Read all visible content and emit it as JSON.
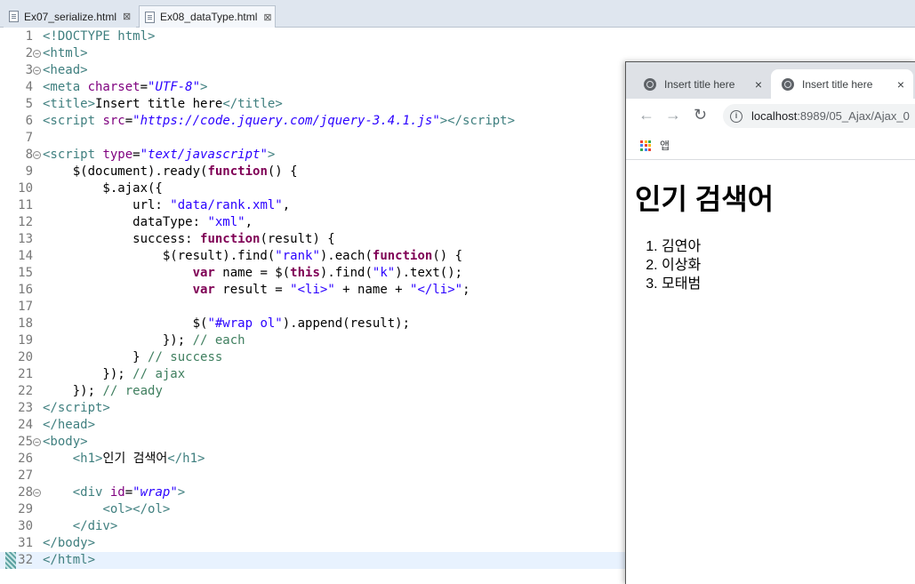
{
  "editor": {
    "tabs": [
      {
        "label": "Ex07_serialize.html",
        "close": "⊠"
      },
      {
        "label": "Ex08_dataType.html",
        "close": "⊠"
      }
    ],
    "lines": [
      {
        "n": "1",
        "fold": "",
        "html": "<span class=\"tag\">&lt;!DOCTYPE html&gt;</span>"
      },
      {
        "n": "2",
        "fold": "−",
        "html": "<span class=\"tag\">&lt;html&gt;</span>"
      },
      {
        "n": "3",
        "fold": "−",
        "html": "<span class=\"tag\">&lt;head&gt;</span>"
      },
      {
        "n": "4",
        "fold": "",
        "html": "<span class=\"tag\">&lt;meta </span><span class=\"attr\">charset</span>=<span class=\"val\">\"UTF-8\"</span><span class=\"tag\">&gt;</span>"
      },
      {
        "n": "5",
        "fold": "",
        "html": "<span class=\"tag\">&lt;title&gt;</span>Insert title here<span class=\"tag\">&lt;/title&gt;</span>"
      },
      {
        "n": "6",
        "fold": "",
        "html": "<span class=\"tag\">&lt;script </span><span class=\"attr\">src</span>=<span class=\"val\">\"https://code.jquery.com/jquery-3.4.1.js\"</span><span class=\"tag\">&gt;&lt;/script&gt;</span>"
      },
      {
        "n": "7",
        "fold": "",
        "html": ""
      },
      {
        "n": "8",
        "fold": "−",
        "html": "<span class=\"tag\">&lt;script </span><span class=\"attr\">type</span>=<span class=\"val\">\"text/javascript\"</span><span class=\"tag\">&gt;</span>"
      },
      {
        "n": "9",
        "fold": "",
        "html": "    $(document).ready(<span class=\"kw\">function</span>() {"
      },
      {
        "n": "10",
        "fold": "",
        "html": "        $.ajax({"
      },
      {
        "n": "11",
        "fold": "",
        "html": "            url: <span class=\"str\">\"data/rank.xml\"</span>,"
      },
      {
        "n": "12",
        "fold": "",
        "html": "            dataType: <span class=\"str\">\"xml\"</span>,"
      },
      {
        "n": "13",
        "fold": "",
        "html": "            success: <span class=\"kw\">function</span>(result) {"
      },
      {
        "n": "14",
        "fold": "",
        "html": "                $(result).find(<span class=\"str\">\"rank\"</span>).each(<span class=\"kw\">function</span>() {"
      },
      {
        "n": "15",
        "fold": "",
        "html": "                    <span class=\"kw\">var</span> name = $(<span class=\"kw\">this</span>).find(<span class=\"str\">\"k\"</span>).text();"
      },
      {
        "n": "16",
        "fold": "",
        "html": "                    <span class=\"kw\">var</span> result = <span class=\"str\">\"&lt;li&gt;\"</span> + name + <span class=\"str\">\"&lt;/li&gt;\"</span>;"
      },
      {
        "n": "17",
        "fold": "",
        "html": ""
      },
      {
        "n": "18",
        "fold": "",
        "html": "                    $(<span class=\"str\">\"#wrap ol\"</span>).append(result);"
      },
      {
        "n": "19",
        "fold": "",
        "html": "                }); <span class=\"cm\">// each</span>"
      },
      {
        "n": "20",
        "fold": "",
        "html": "            } <span class=\"cm\">// success</span>"
      },
      {
        "n": "21",
        "fold": "",
        "html": "        }); <span class=\"cm\">// ajax</span>"
      },
      {
        "n": "22",
        "fold": "",
        "html": "    }); <span class=\"cm\">// ready</span>"
      },
      {
        "n": "23",
        "fold": "",
        "html": "<span class=\"tag\">&lt;/script&gt;</span>"
      },
      {
        "n": "24",
        "fold": "",
        "html": "<span class=\"tag\">&lt;/head&gt;</span>"
      },
      {
        "n": "25",
        "fold": "−",
        "html": "<span class=\"tag\">&lt;body&gt;</span>"
      },
      {
        "n": "26",
        "fold": "",
        "html": "    <span class=\"tag\">&lt;h1&gt;</span>인기 검색어<span class=\"tag\">&lt;/h1&gt;</span>"
      },
      {
        "n": "27",
        "fold": "",
        "html": ""
      },
      {
        "n": "28",
        "fold": "−",
        "html": "    <span class=\"tag\">&lt;div </span><span class=\"attr\">id</span>=<span class=\"val\">\"wrap\"</span><span class=\"tag\">&gt;</span>"
      },
      {
        "n": "29",
        "fold": "",
        "html": "        <span class=\"tag\">&lt;ol&gt;&lt;/ol&gt;</span>"
      },
      {
        "n": "30",
        "fold": "",
        "html": "    <span class=\"tag\">&lt;/div&gt;</span>"
      },
      {
        "n": "31",
        "fold": "",
        "html": "<span class=\"tag\">&lt;/body&gt;</span>"
      },
      {
        "n": "32",
        "fold": "",
        "html": "<span class=\"tag\">&lt;/html&gt;</span>"
      }
    ]
  },
  "browser": {
    "tabs": [
      {
        "label": "Insert title here",
        "close": "×"
      },
      {
        "label": "Insert title here",
        "close": "×"
      }
    ],
    "back": "←",
    "forward": "→",
    "reload": "↻",
    "info": "i",
    "url_host": "localhost",
    "url_rest": ":8989/05_Ajax/Ajax_0",
    "bookmark_label": "앱",
    "apps_colors": [
      "#ea4335",
      "#fbbc05",
      "#34a853",
      "#4285f4",
      "#ea4335",
      "#fbbc05",
      "#34a853",
      "#4285f4",
      "#ea4335"
    ],
    "page": {
      "heading": "인기 검색어",
      "items": [
        "김연아",
        "이상화",
        "모태범"
      ]
    }
  }
}
